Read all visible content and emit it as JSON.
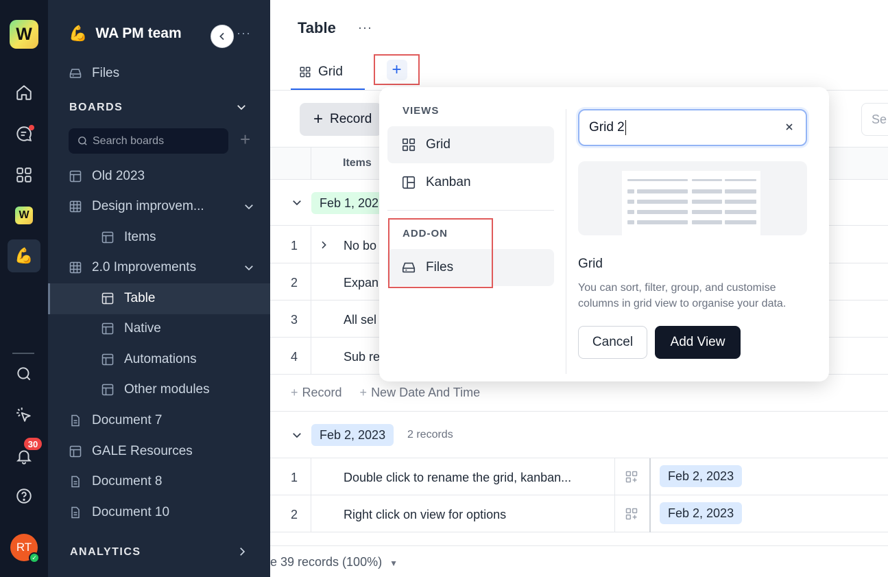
{
  "rail": {
    "logo_letter": "W",
    "workspace_letter": "W",
    "team_emoji": "💪",
    "notification_count": "30",
    "avatar_initials": "RT"
  },
  "sidebar": {
    "team_name": "WA PM team",
    "team_emoji": "💪",
    "more": "···",
    "files_label": "Files",
    "boards_section": "BOARDS",
    "search_placeholder": "Search boards",
    "items": [
      {
        "label": "Old 2023"
      },
      {
        "label": "Design improvem..."
      },
      {
        "label": "Items"
      },
      {
        "label": "2.0 Improvements"
      },
      {
        "label": "Table"
      },
      {
        "label": "Native"
      },
      {
        "label": "Automations"
      },
      {
        "label": "Other modules"
      },
      {
        "label": "Document 7"
      },
      {
        "label": "GALE Resources"
      },
      {
        "label": "Document 8"
      },
      {
        "label": "Document 10"
      }
    ],
    "analytics_section": "ANALYTICS"
  },
  "main": {
    "title": "Table",
    "more": "···",
    "tab_grid": "Grid",
    "add_view": "+",
    "record_button": "Record",
    "search_placeholder": "Se",
    "column_items": "Items",
    "group1": {
      "date": "Feb 1, 202",
      "rows": [
        {
          "num": "1",
          "text": "No bo"
        },
        {
          "num": "2",
          "text": "Expan"
        },
        {
          "num": "3",
          "text": "All sel"
        },
        {
          "num": "4",
          "text": "Sub re"
        }
      ],
      "add_record": "Record",
      "add_date": "New Date And Time"
    },
    "group2": {
      "date": "Feb 2, 2023",
      "count": "2 records",
      "rows": [
        {
          "num": "1",
          "text": "Double click to rename the grid, kanban...",
          "date": "Feb 2, 2023"
        },
        {
          "num": "2",
          "text": "Right click on view for options",
          "date": "Feb 2, 2023"
        }
      ]
    },
    "footer": "e 39 records (100%)"
  },
  "popup": {
    "views_section": "VIEWS",
    "views": [
      {
        "label": "Grid"
      },
      {
        "label": "Kanban"
      }
    ],
    "addon_section": "ADD-ON",
    "addons": [
      {
        "label": "Files"
      }
    ],
    "name_value": "Grid 2",
    "desc_title": "Grid",
    "desc_text": "You can sort, filter, group, and customise columns in grid view to organise your data.",
    "cancel": "Cancel",
    "add_view": "Add View"
  }
}
